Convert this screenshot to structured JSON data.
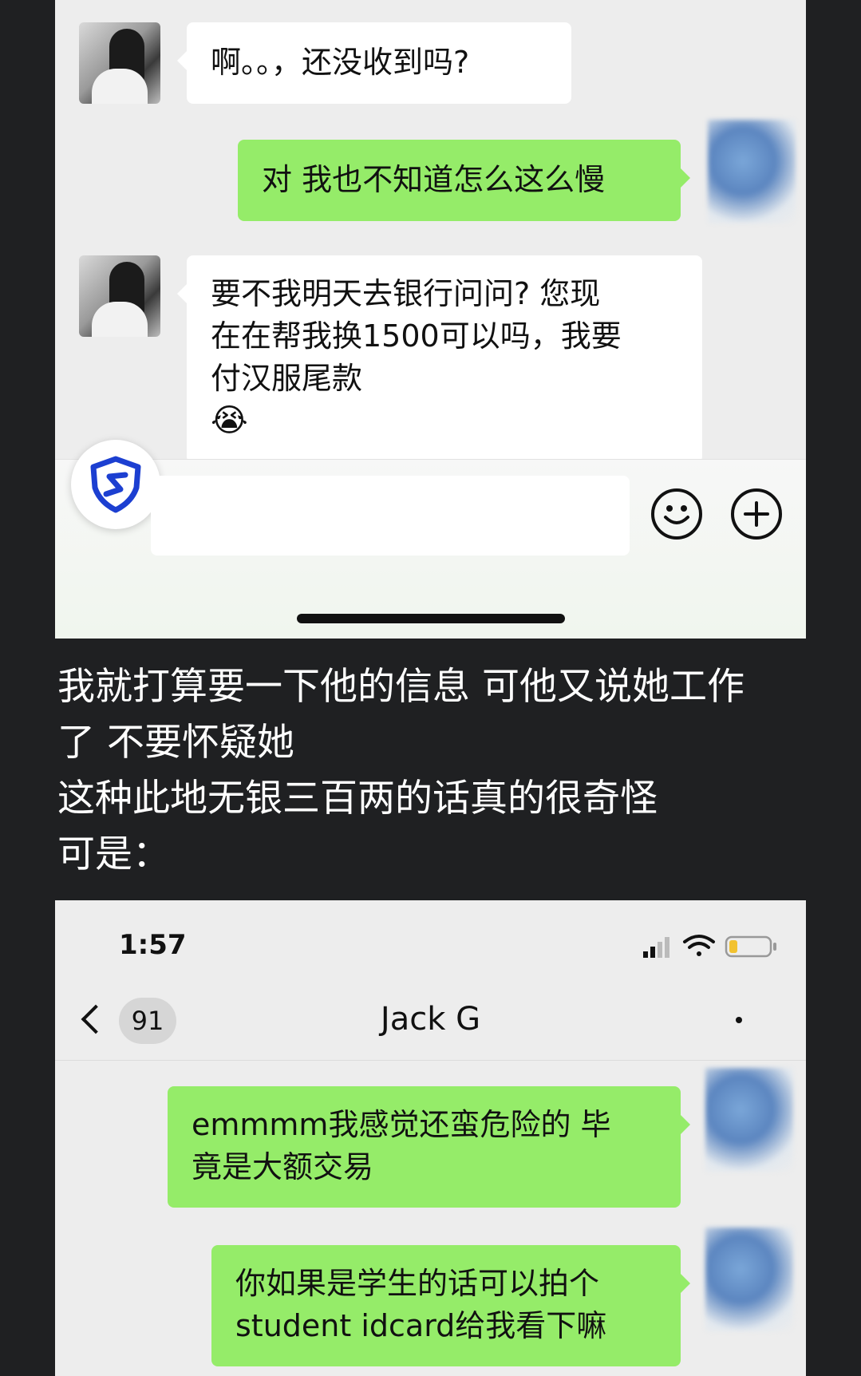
{
  "top_chat": {
    "messages": [
      {
        "side": "in",
        "text": "啊。。，还没收到吗?"
      },
      {
        "side": "out",
        "text": "对 我也不知道怎么这么慢"
      },
      {
        "side": "in",
        "lines": [
          "要不我明天去银行问问? 您现",
          "在在帮我换1500可以吗，我要",
          "付汉服尾款"
        ],
        "emoji": "😭"
      }
    ],
    "input_bar": {
      "emoji_icon": "emoji-icon",
      "plus_icon": "plus-icon",
      "shield_icon": "shield-icon"
    }
  },
  "commentary": {
    "lines": [
      "我就打算要一下他的信息 可他又说她工作",
      "了 不要怀疑她",
      "这种此地无银三百两的话真的很奇怪",
      "可是："
    ]
  },
  "bottom_chat": {
    "status_bar": {
      "time": "1:57"
    },
    "nav": {
      "back_count": "91",
      "title": "Jack G"
    },
    "messages": [
      {
        "side": "out",
        "lines": [
          "emmmm我感觉还蛮危险的 毕",
          "竟是大额交易"
        ]
      },
      {
        "side": "out",
        "lines": [
          "你如果是学生的话可以拍个",
          "student idcard给我看下嘛"
        ]
      }
    ]
  },
  "colors": {
    "bubble_out": "#95ec69",
    "bubble_in": "#ffffff",
    "chat_bg": "#ededed",
    "page_bg": "#1f2022"
  }
}
